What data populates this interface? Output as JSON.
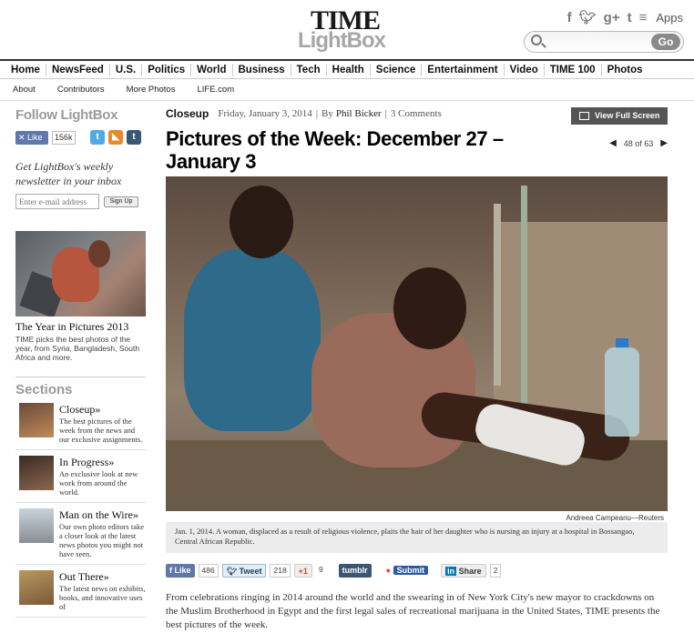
{
  "header": {
    "logo_top": "TIME",
    "logo_bottom": "LightBox",
    "social": [
      "f",
      "t",
      "g+",
      "t",
      "rss"
    ],
    "apps_label": "Apps",
    "search": {
      "placeholder": "",
      "go_label": "Go"
    }
  },
  "main_nav": [
    "Home",
    "NewsFeed",
    "U.S.",
    "Politics",
    "World",
    "Business",
    "Tech",
    "Health",
    "Science",
    "Entertainment",
    "Video",
    "TIME 100",
    "Photos"
  ],
  "sub_nav": [
    "About",
    "Contributors",
    "More Photos",
    "LIFE.com"
  ],
  "sidebar": {
    "follow_title": "Follow LightBox",
    "fb_like": "Like",
    "fb_count": "156k",
    "newsletter_text": "Get LightBox's weekly newsletter in your inbox",
    "email_placeholder": "Enter e-mail address",
    "signup_label": "Sign Up",
    "year_title": "The Year in Pictures 2013",
    "year_desc": "TIME picks the best photos of the year, from Syria, Bangladesh, South Africa and more.",
    "sections_title": "Sections",
    "sections": [
      {
        "title": "Closeup»",
        "desc": "The best pictures of the week from the news and our exclusive assignments.",
        "color": "#6b4a3a"
      },
      {
        "title": "In Progress»",
        "desc": "An exclusive look at new work from around the world.",
        "color": "#5a3e30"
      },
      {
        "title": "Man on the Wire»",
        "desc": "Our own photo editors take a closer look at the latest news photos you might not have seen.",
        "color": "#9aa4b0"
      },
      {
        "title": "Out There»",
        "desc": "The latest news on exhibits, books, and innovative uses of",
        "color": "#b8975e"
      }
    ]
  },
  "article": {
    "kicker": "Closeup",
    "date": "Friday, January 3, 2014",
    "by_prefix": "By",
    "author": "Phil Bicker",
    "comments": "3 Comments",
    "fullscreen_label": "View Full Screen",
    "headline": "Pictures of the Week: December 27 – January 3",
    "pager": "48 of 63",
    "photo_credit": "Andreea Campeanu—Reuters",
    "caption": "Jan. 1, 2014. A woman, displaced as a result of religious violence, plaits the hair of her daughter who is nursing an injury at a hospital in Bossangao, Central African Republic.",
    "share": {
      "fb_like": "Like",
      "fb_count": "486",
      "tweet": "Tweet",
      "tweet_count": "218",
      "gplus": "+1",
      "gplus_count": "9",
      "tumblr": "tumblr",
      "submit": "Submit",
      "linkedin": "Share",
      "linkedin_count": "2"
    },
    "body": "From celebrations ringing in 2014 around the world and the swearing in of New York City's new mayor to crackdowns on the Muslim Brotherhood in Egypt and the first legal sales of recreational marijuana in the United States, TIME presents the best pictures of the week."
  }
}
